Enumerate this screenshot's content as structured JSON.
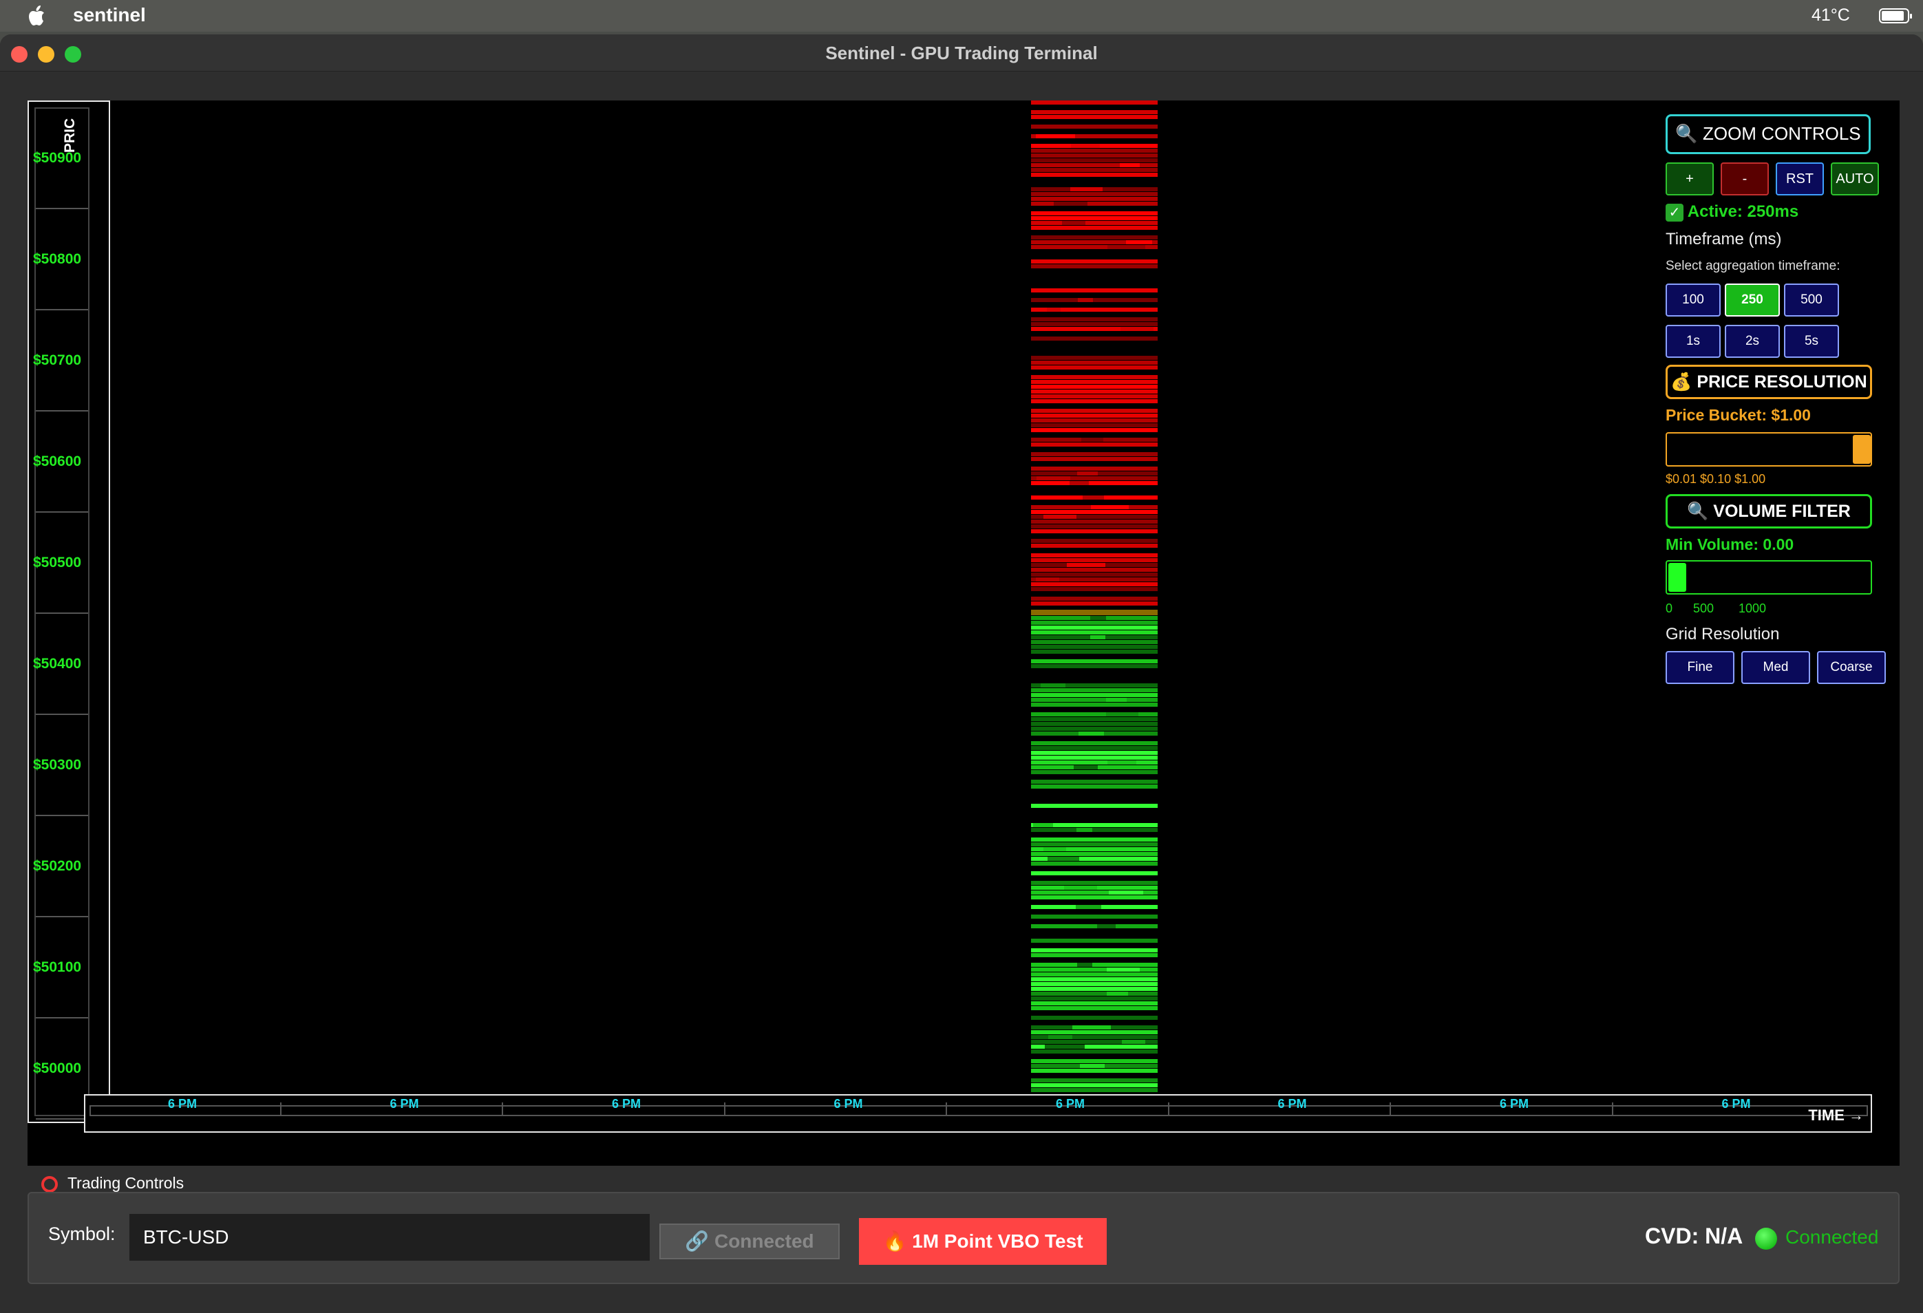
{
  "menubar": {
    "app_name": "sentinel",
    "temperature": "41°C"
  },
  "window": {
    "title": "Sentinel - GPU Trading Terminal"
  },
  "price_axis": {
    "title": "PRIC",
    "labels": [
      "$50900",
      "$50800",
      "$50700",
      "$50600",
      "$50500",
      "$50400",
      "$50300",
      "$50200",
      "$50100",
      "$50000"
    ]
  },
  "time_axis": {
    "labels": [
      "6 PM",
      "6 PM",
      "6 PM",
      "6 PM",
      "6 PM",
      "6 PM",
      "6 PM",
      "6 PM"
    ],
    "title": "TIME →"
  },
  "zoom": {
    "title": "ZOOM CONTROLS",
    "plus": "+",
    "minus": "-",
    "reset": "RST",
    "auto": "AUTO",
    "active": "Active: 250ms"
  },
  "timeframe": {
    "title": "Timeframe (ms)",
    "subtitle": "Select aggregation timeframe:",
    "options": [
      "100",
      "250",
      "500",
      "1s",
      "2s",
      "5s"
    ],
    "selected": "250"
  },
  "price_resolution": {
    "title": "PRICE RESOLUTION",
    "bucket": "Price Bucket: $1.00",
    "scale": "$0.01 $0.10 $1.00",
    "slider_value": 1.0
  },
  "volume_filter": {
    "title": "VOLUME FILTER",
    "min_volume": "Min Volume: 0.00",
    "scale": [
      "0",
      "500",
      "1000"
    ],
    "slider_value": 0
  },
  "grid_resolution": {
    "title": "Grid Resolution",
    "options": [
      "Fine",
      "Med",
      "Coarse"
    ]
  },
  "trading_controls": {
    "label": "Trading Controls",
    "symbol_label": "Symbol:",
    "symbol_value": "BTC-USD",
    "connect_label": "Connected",
    "vbo_label": "1M Point VBO Test",
    "cvd": "CVD: N/A",
    "status": "Connected"
  },
  "colors": {
    "ask": "#dd0000",
    "bid": "#22dd22",
    "accent_cyan": "#33d4d4",
    "accent_orange": "#f5a623",
    "vbo_button": "#ff4444"
  }
}
